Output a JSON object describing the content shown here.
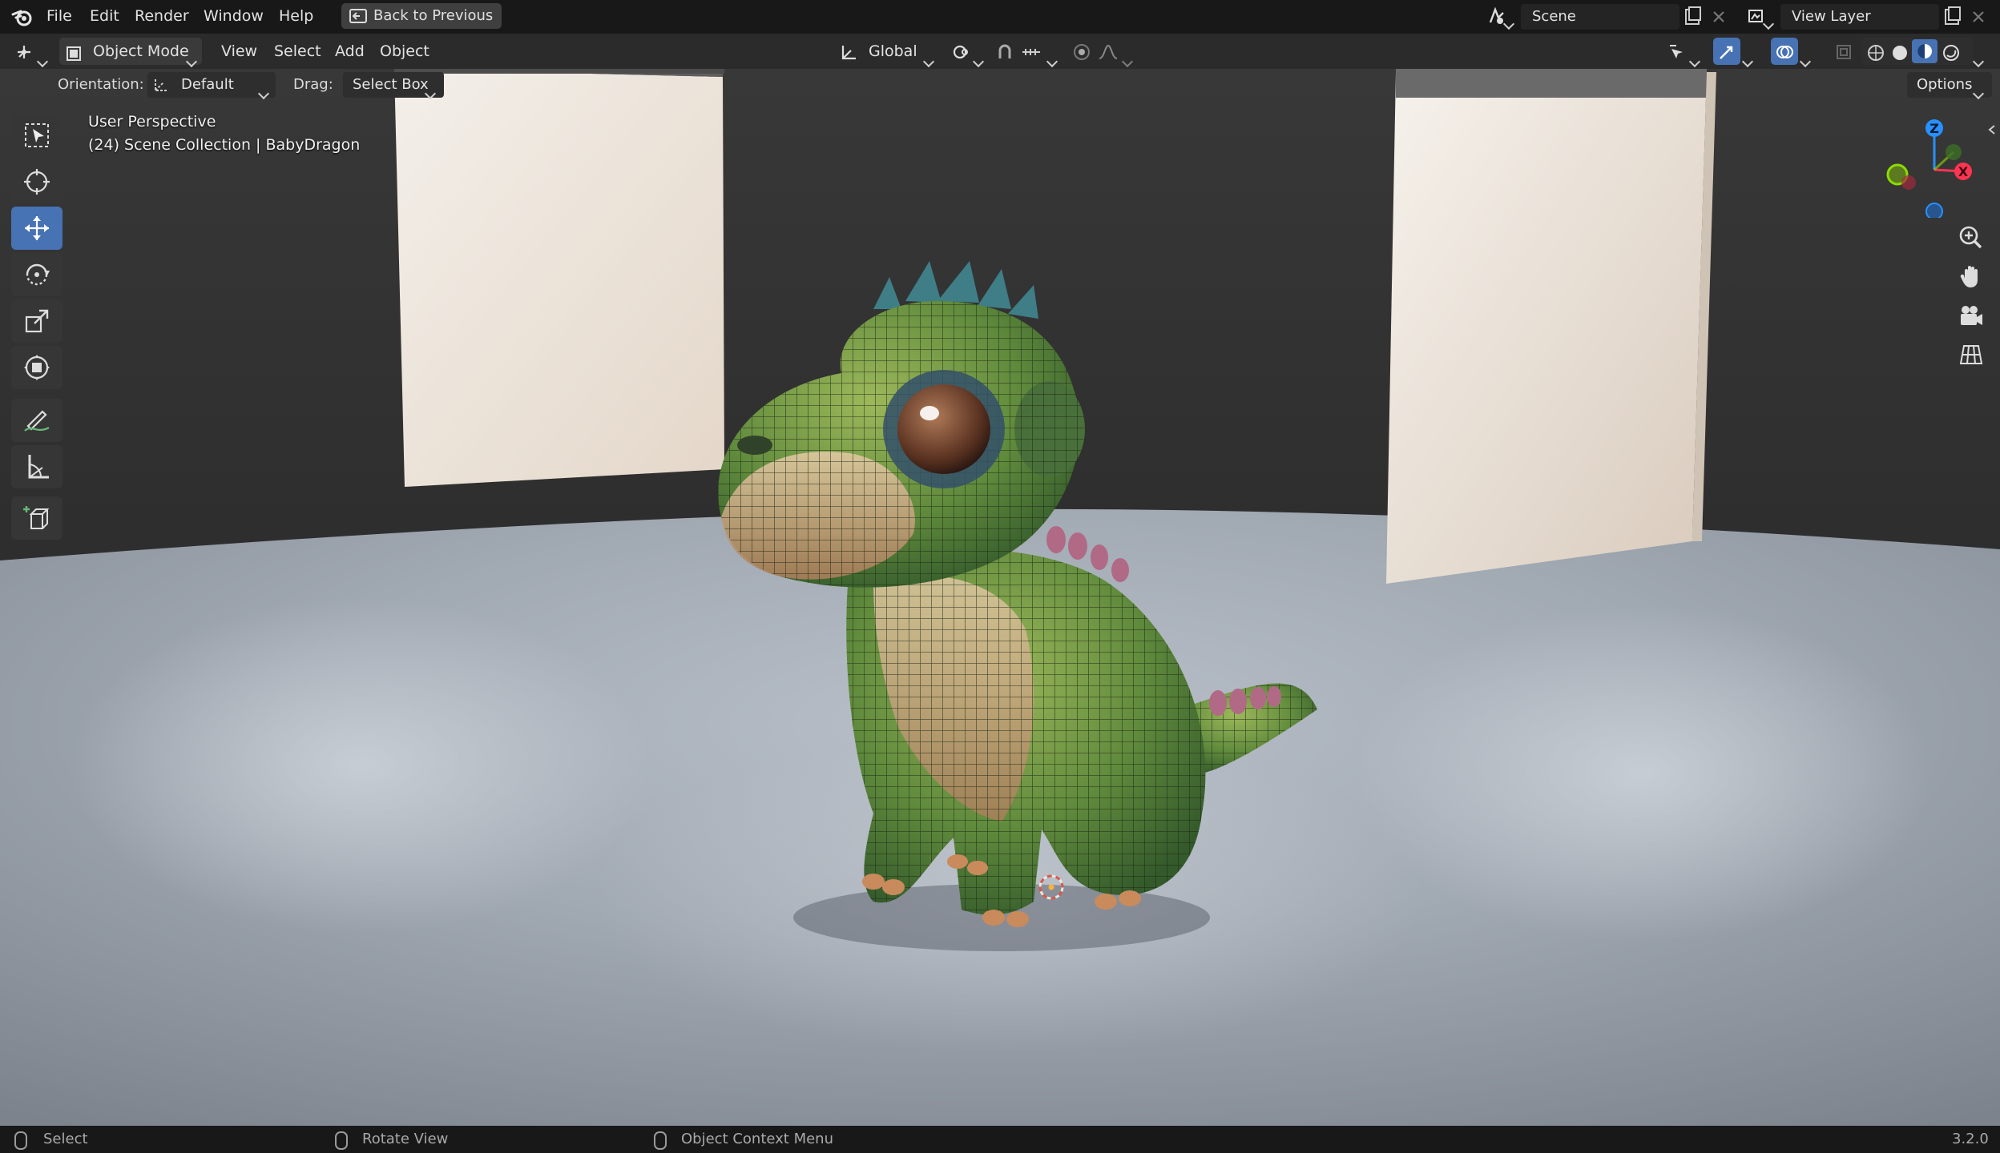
{
  "topbar": {
    "menus": [
      "File",
      "Edit",
      "Render",
      "Window",
      "Help"
    ],
    "back_button": "Back to Previous",
    "scene_name": "Scene",
    "view_layer_name": "View Layer"
  },
  "viewport_header": {
    "mode": "Object Mode",
    "menus": [
      "View",
      "Select",
      "Add",
      "Object"
    ],
    "transform_orientation": "Global"
  },
  "tool_settings": {
    "orientation_label": "Orientation:",
    "orientation_value": "Default",
    "drag_label": "Drag:",
    "drag_value": "Select Box",
    "options_label": "Options"
  },
  "toolbar": {
    "active_tool": "move",
    "tools": [
      "select-box",
      "cursor",
      "move",
      "rotate",
      "scale",
      "transform",
      "annotate",
      "measure",
      "add-cube"
    ]
  },
  "viewport": {
    "view_name": "User Perspective",
    "collection_info": "(24) Scene Collection | BabyDragon",
    "object_name": "BabyDragon"
  },
  "gizmo": {
    "axes": [
      "Z",
      "X"
    ],
    "colors": {
      "x": "#ff3352",
      "y": "#8bdc00",
      "z": "#2890ff"
    }
  },
  "statusbar": {
    "left_mouse": "Select",
    "middle_mouse": "Rotate View",
    "right_mouse": "Object Context Menu",
    "version": "3.2.0"
  },
  "colors": {
    "accent": "#4772b3",
    "header": "#181818",
    "viewport_bg": "#3b3b3b"
  }
}
